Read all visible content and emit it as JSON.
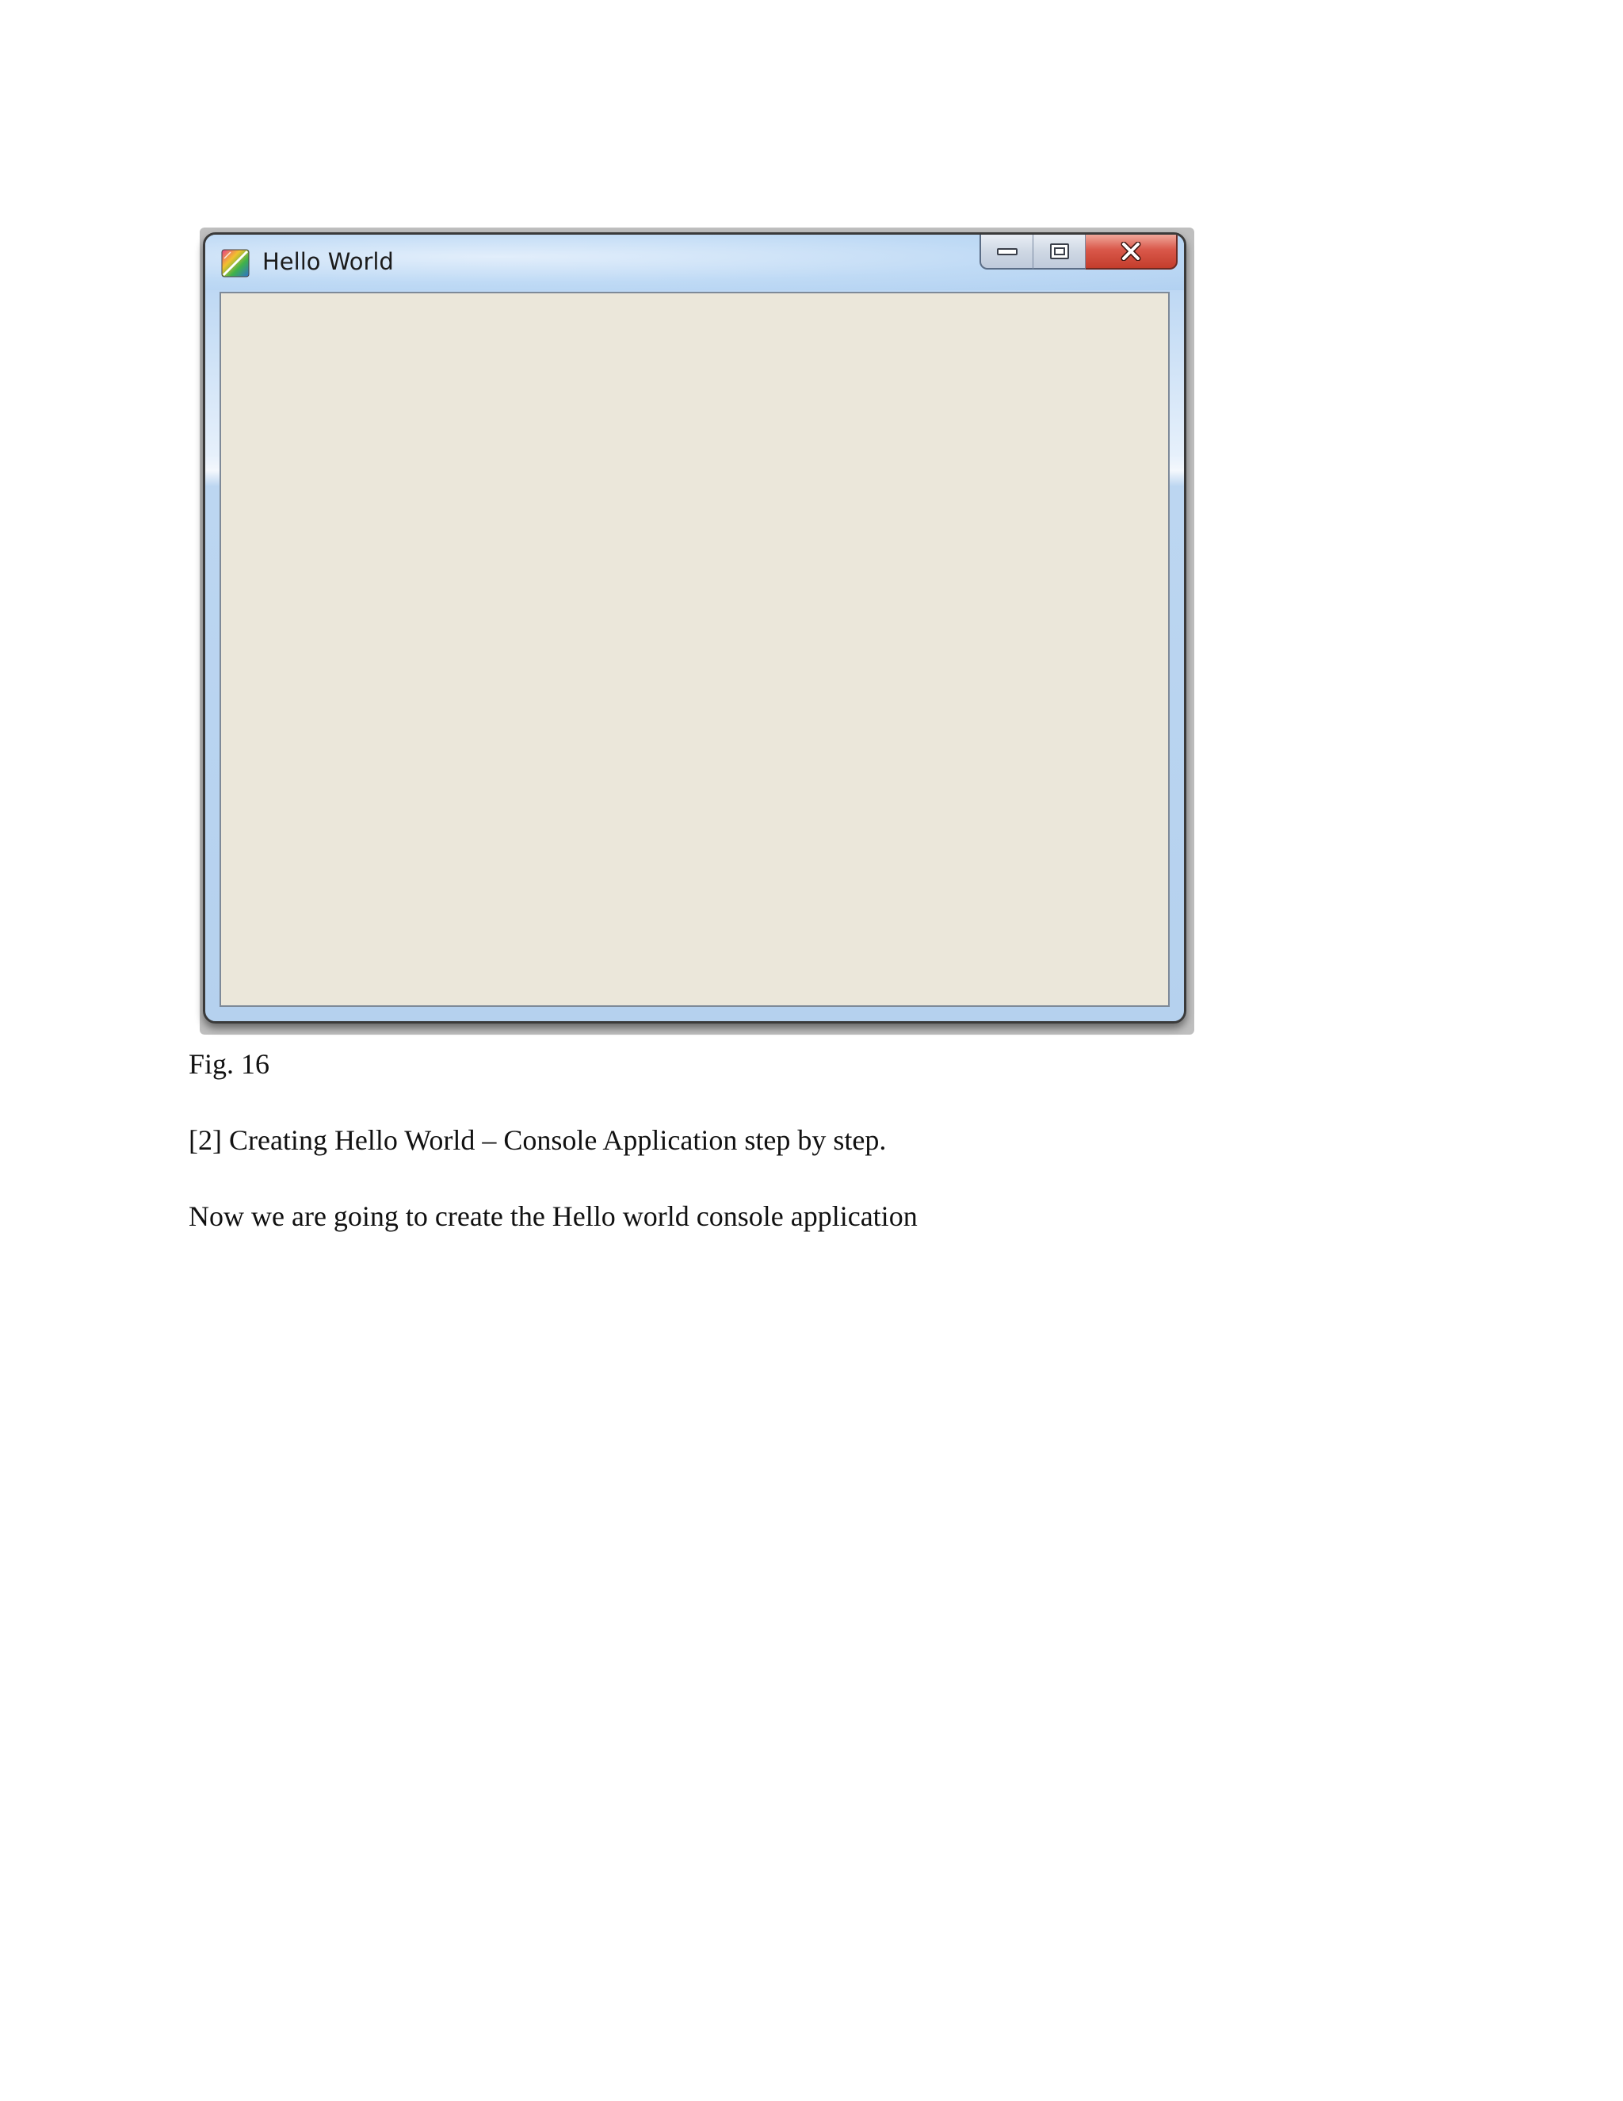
{
  "window": {
    "title": "Hello World",
    "icon": "app-icon",
    "buttons": {
      "minimize": "minimize-icon",
      "maximize": "maximize-icon",
      "close": "close-icon"
    }
  },
  "document": {
    "caption": "Fig. 16",
    "paragraphs": [
      "[2] Creating Hello World – Console Application step by step.",
      "Now we are going to create the Hello world console application"
    ]
  }
}
